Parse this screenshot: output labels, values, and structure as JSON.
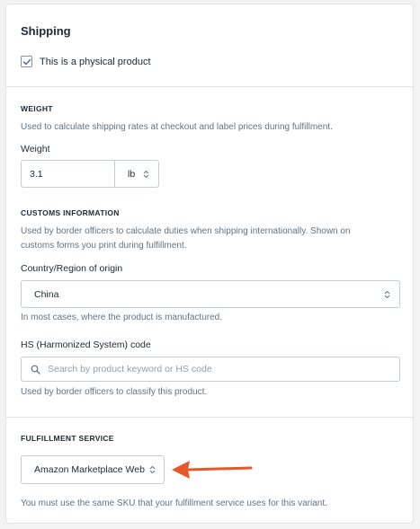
{
  "shipping": {
    "title": "Shipping",
    "physical_label": "This is a physical product",
    "physical_checked": true
  },
  "weight": {
    "heading": "WEIGHT",
    "help": "Used to calculate shipping rates at checkout and label prices during fulfillment.",
    "label": "Weight",
    "value": "3.1",
    "unit": "lb"
  },
  "customs": {
    "heading": "CUSTOMS INFORMATION",
    "help_line1": "Used by border officers to calculate duties when shipping internationally. Shown on",
    "help_line2": "customs forms you print during fulfillment.",
    "country_label": "Country/Region of origin",
    "country_value": "China",
    "country_help": "In most cases, where the product is manufactured.",
    "hs_label": "HS (Harmonized System) code",
    "hs_placeholder": "Search by product keyword or HS code",
    "hs_help": "Used by border officers to classify this product."
  },
  "fulfillment": {
    "heading": "FULFILLMENT SERVICE",
    "service_value": "Amazon Marketplace Web",
    "sku_note": "You must use the same SKU that your fulfillment service uses for this variant."
  },
  "colors": {
    "arrow": "#e8562a",
    "checkbox_accent": "#5c6ac4"
  }
}
